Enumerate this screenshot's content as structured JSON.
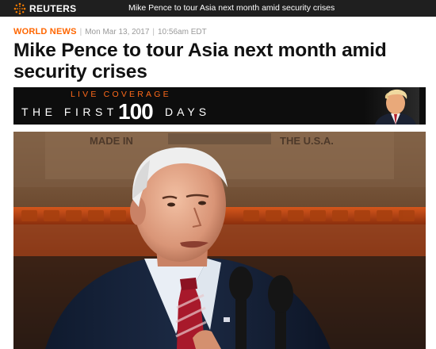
{
  "topbar": {
    "brand": "REUTERS",
    "headline": "Mike Pence to tour Asia next month amid security crises"
  },
  "article": {
    "section": "WORLD NEWS",
    "date": "Mon Mar 13, 2017",
    "time": "10:56am EDT",
    "title": "Mike Pence to tour Asia next month amid security crises"
  },
  "banner": {
    "live": "LIVE COVERAGE",
    "first": "THE FIRST",
    "number": "100",
    "days": "DAYS"
  },
  "photo": {
    "crate_left": "MADE IN",
    "crate_right": "THE U.S.A."
  },
  "colors": {
    "brand_orange": "#ff6600",
    "topbar_bg": "#1f1f1f",
    "banner_bg": "#0d0d0d"
  },
  "icons": [
    "reuters-logo-icon"
  ]
}
